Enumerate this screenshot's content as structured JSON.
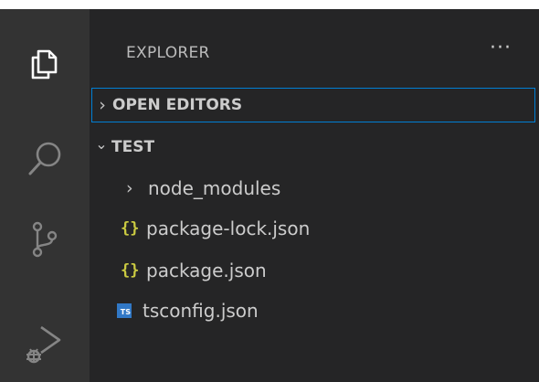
{
  "activity_bar": {
    "items": [
      {
        "name": "explorer",
        "icon": "files-icon",
        "active": true
      },
      {
        "name": "search",
        "icon": "search-icon",
        "active": false
      },
      {
        "name": "source-control",
        "icon": "source-control-icon",
        "active": false
      },
      {
        "name": "run-debug",
        "icon": "run-debug-icon",
        "active": false
      }
    ]
  },
  "sidebar": {
    "title": "EXPLORER",
    "more_actions": "···",
    "sections": [
      {
        "label": "OPEN EDITORS",
        "expanded": false,
        "chevron": "›"
      },
      {
        "label": "TEST",
        "expanded": true,
        "chevron": "⌄"
      }
    ],
    "tree": [
      {
        "label": "node_modules",
        "type": "folder",
        "icon": "chevron-right-icon",
        "glyph": "›"
      },
      {
        "label": "package-lock.json",
        "type": "json",
        "icon": "json-icon",
        "glyph": "{}"
      },
      {
        "label": "package.json",
        "type": "json",
        "icon": "json-icon",
        "glyph": "{}"
      },
      {
        "label": "tsconfig.json",
        "type": "ts",
        "icon": "typescript-icon",
        "glyph": "TS"
      }
    ]
  },
  "colors": {
    "activity_bar_bg": "#333333",
    "sidebar_bg": "#252526",
    "focus_border": "#007fd4",
    "json_icon": "#cbcb41",
    "ts_icon": "#3178c6",
    "text": "#cccccc"
  }
}
